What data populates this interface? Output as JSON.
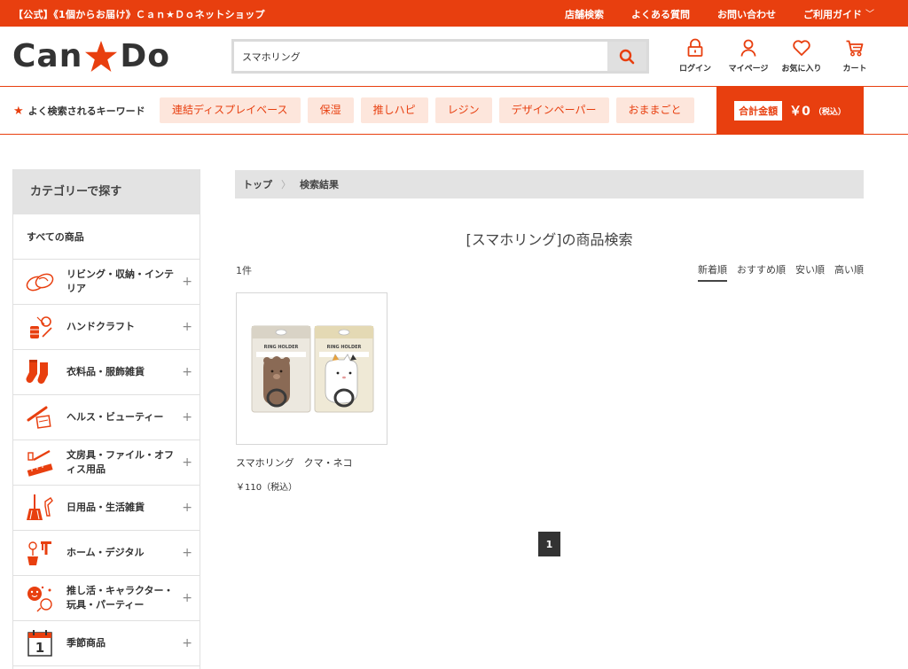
{
  "topbar": {
    "tagline": "【公式】《1個からお届け》Ｃａｎ★Ｄｏネットショップ",
    "links": [
      "店舗検索",
      "よくある質問",
      "お問い合わせ",
      "ご利用ガイド"
    ],
    "guide_chevron": "﹀"
  },
  "header": {
    "logo_left": "Can",
    "logo_right": "Do",
    "search": {
      "value": "スマホリング",
      "placeholder": ""
    },
    "icons": [
      {
        "name": "lock-icon",
        "label": "ログイン"
      },
      {
        "name": "user-icon",
        "label": "マイページ"
      },
      {
        "name": "heart-icon",
        "label": "お気に入り"
      },
      {
        "name": "cart-icon",
        "label": "カート"
      }
    ]
  },
  "keywords": {
    "title_star": "★",
    "title": "よく検索されるキーワード",
    "items": [
      "連結ディスプレイベース",
      "保湿",
      "推しハピ",
      "レジン",
      "デザインペーパー",
      "おままごと"
    ]
  },
  "total": {
    "label": "合計金額",
    "value": "￥0",
    "tax": "（税込）"
  },
  "sidebar": {
    "heading": "カテゴリーで探す",
    "all": "すべての商品",
    "categories": [
      {
        "label": "リビング・収納・インテリア",
        "icon": "slippers-icon"
      },
      {
        "label": "ハンドクラフト",
        "icon": "craft-icon"
      },
      {
        "label": "衣料品・服飾雑貨",
        "icon": "socks-icon"
      },
      {
        "label": "ヘルス・ビューティー",
        "icon": "beauty-icon"
      },
      {
        "label": "文房具・ファイル・オフィス用品",
        "icon": "stationery-icon"
      },
      {
        "label": "日用品・生活雑貨",
        "icon": "broom-icon"
      },
      {
        "label": "ホーム・デジタル",
        "icon": "tools-icon"
      },
      {
        "label": "推し活・キャラクター・玩具・パーティー",
        "icon": "party-icon"
      },
      {
        "label": "季節商品",
        "icon": "calendar-icon"
      }
    ],
    "calendar_number": "1",
    "expand_symbol": "+"
  },
  "breadcrumb": {
    "home": "トップ",
    "separator": "〉",
    "current": "検索結果"
  },
  "results": {
    "title": "[スマホリング]の商品検索",
    "count": "1件",
    "sorts": [
      "新着順",
      "おすすめ順",
      "安い順",
      "高い順"
    ],
    "active_sort": 0
  },
  "product": {
    "name": "スマホリング　クマ・ネコ",
    "price": "￥110（税込）",
    "package_text": "RING HOLDER"
  },
  "pagination": {
    "current": "1"
  },
  "colors": {
    "brand": "#e83f0f",
    "chip_bg": "#fde6dc",
    "panel_gray": "#e3e3e3"
  }
}
